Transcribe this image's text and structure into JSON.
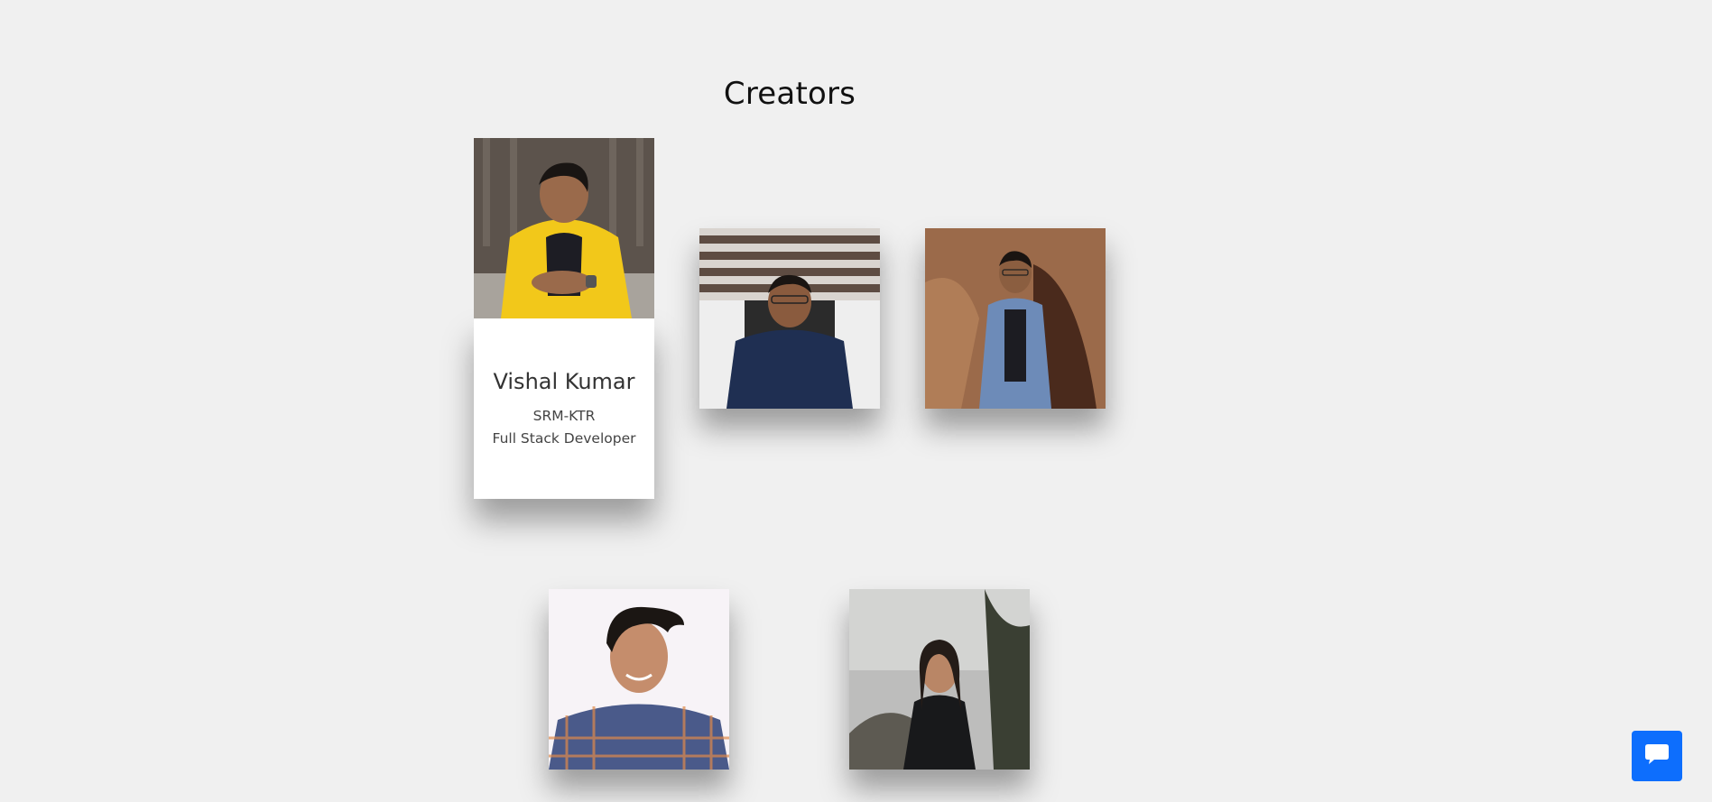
{
  "page": {
    "title": "Creators"
  },
  "creators": [
    {
      "name": "Vishal Kumar",
      "college": "SRM-KTR",
      "role": "Full Stack Developer"
    },
    {
      "name": "",
      "college": "",
      "role": ""
    },
    {
      "name": "",
      "college": "",
      "role": ""
    },
    {
      "name": "",
      "college": "",
      "role": ""
    },
    {
      "name": "",
      "college": "",
      "role": ""
    }
  ],
  "chat": {
    "icon": "chat-bubble-icon",
    "color": "#0d6efd"
  },
  "colors": {
    "background": "#f0f0f0",
    "card": "#ffffff",
    "accent": "#0d6efd"
  }
}
